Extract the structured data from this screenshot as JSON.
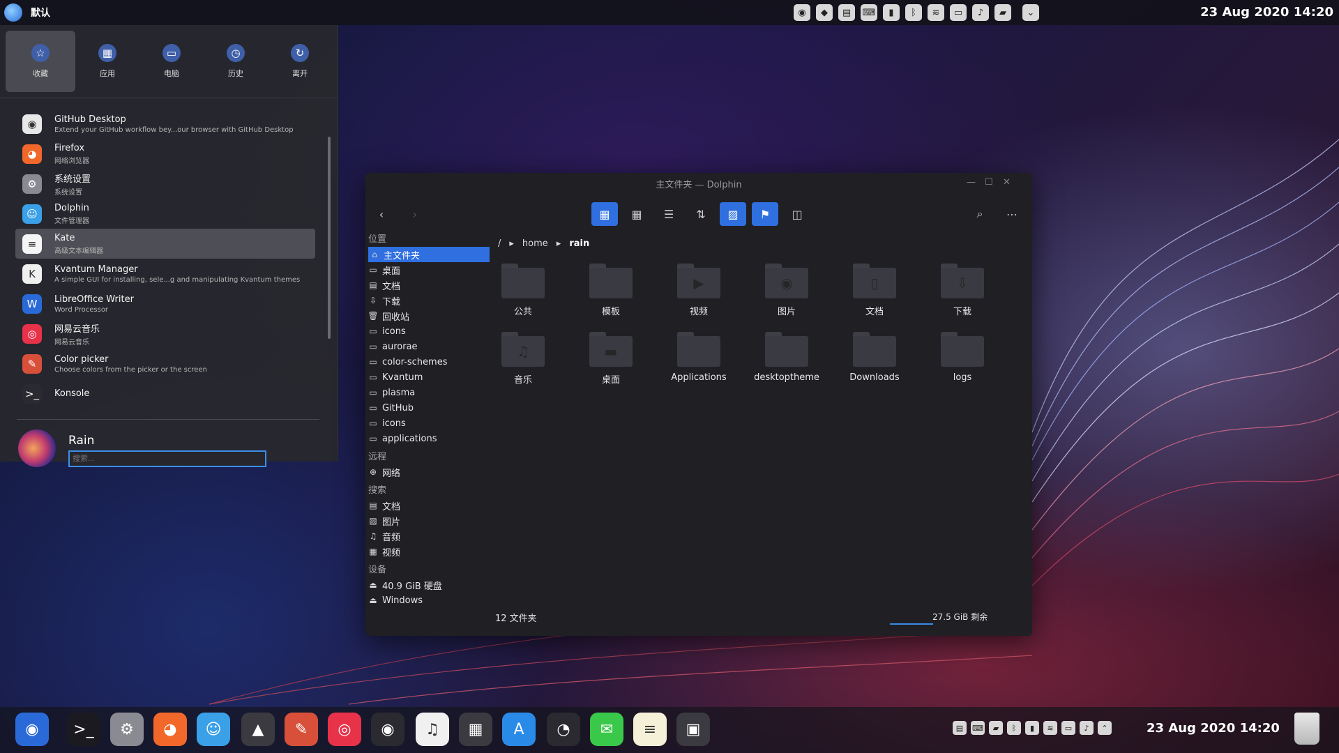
{
  "topbar": {
    "title": "默认",
    "clock": "23 Aug 2020 14:20",
    "tray_icons": [
      "screenshot-icon",
      "notification-icon",
      "clipboard-icon",
      "keyboard-icon",
      "battery-icon",
      "bluetooth-icon",
      "wifi-icon",
      "display-icon",
      "volume-icon",
      "battery-status-icon"
    ]
  },
  "launcher": {
    "tabs": [
      {
        "label": "收藏",
        "icon": "star-icon",
        "glyph": "☆"
      },
      {
        "label": "应用",
        "icon": "apps-icon",
        "glyph": "▦"
      },
      {
        "label": "电脑",
        "icon": "computer-icon",
        "glyph": "▭"
      },
      {
        "label": "历史",
        "icon": "history-icon",
        "glyph": "◷"
      },
      {
        "label": "离开",
        "icon": "leave-icon",
        "glyph": "↻"
      }
    ],
    "apps": [
      {
        "name": "GitHub Desktop",
        "desc": "Extend your GitHub workflow bey...our browser with GitHub Desktop",
        "color": "#e8e8e8",
        "glyph": "◉"
      },
      {
        "name": "Firefox",
        "desc": "网络浏览器",
        "color": "#f2672a",
        "glyph": "◕"
      },
      {
        "name": "系统设置",
        "desc": "系统设置",
        "color": "#8a8a92",
        "glyph": "⚙"
      },
      {
        "name": "Dolphin",
        "desc": "文件管理器",
        "color": "#3aa0e8",
        "glyph": "☺"
      },
      {
        "name": "Kate",
        "desc": "高级文本编辑器",
        "color": "#f5f5f5",
        "glyph": "≡"
      },
      {
        "name": "Kvantum Manager",
        "desc": "A simple GUI for installing, sele...g and manipulating Kvantum themes",
        "color": "#f0f0f0",
        "glyph": "K"
      },
      {
        "name": "LibreOffice Writer",
        "desc": "Word Processor",
        "color": "#2a6ad8",
        "glyph": "W"
      },
      {
        "name": "网易云音乐",
        "desc": "网易云音乐",
        "color": "#e8324a",
        "glyph": "◎"
      },
      {
        "name": "Color picker",
        "desc": "Choose colors from the picker or the screen",
        "color": "#d8503a",
        "glyph": "✎"
      },
      {
        "name": "Konsole",
        "desc": "",
        "color": "#2a2a30",
        "glyph": ">_"
      }
    ],
    "user": "Rain",
    "search_placeholder": "搜索..."
  },
  "dolphin": {
    "title": "主文件夹 — Dolphin",
    "breadcrumb": [
      "/",
      "home",
      "rain"
    ],
    "places_sections": {
      "places": "位置",
      "remote": "远程",
      "search": "搜索",
      "devices": "设备"
    },
    "places": [
      {
        "label": "主文件夹",
        "glyph": "⌂"
      },
      {
        "label": "桌面",
        "glyph": "▭"
      },
      {
        "label": "文档",
        "glyph": "▤"
      },
      {
        "label": "下载",
        "glyph": "⇩"
      },
      {
        "label": "回收站",
        "glyph": "🗑"
      },
      {
        "label": "icons",
        "glyph": "▭"
      },
      {
        "label": "aurorae",
        "glyph": "▭"
      },
      {
        "label": "color-schemes",
        "glyph": "▭"
      },
      {
        "label": "Kvantum",
        "glyph": "▭"
      },
      {
        "label": "plasma",
        "glyph": "▭"
      },
      {
        "label": "GitHub",
        "glyph": "▭"
      },
      {
        "label": "icons",
        "glyph": "▭"
      },
      {
        "label": "applications",
        "glyph": "▭"
      }
    ],
    "remote": [
      {
        "label": "网络",
        "glyph": "⊕"
      }
    ],
    "search": [
      {
        "label": "文档",
        "glyph": "▤"
      },
      {
        "label": "图片",
        "glyph": "▨"
      },
      {
        "label": "音频",
        "glyph": "♫"
      },
      {
        "label": "视频",
        "glyph": "▦"
      }
    ],
    "devices": [
      {
        "label": "40.9 GiB 硬盘",
        "glyph": "⏏"
      },
      {
        "label": "Windows",
        "glyph": "⏏"
      }
    ],
    "items": [
      {
        "label": "公共",
        "glyph": ""
      },
      {
        "label": "模板",
        "glyph": ""
      },
      {
        "label": "视频",
        "glyph": "▶"
      },
      {
        "label": "图片",
        "glyph": "◉"
      },
      {
        "label": "文档",
        "glyph": "▯"
      },
      {
        "label": "下载",
        "glyph": "⇩"
      },
      {
        "label": "音乐",
        "glyph": "♫"
      },
      {
        "label": "桌面",
        "glyph": "▬"
      },
      {
        "label": "Applications",
        "glyph": ""
      },
      {
        "label": "desktoptheme",
        "glyph": ""
      },
      {
        "label": "Downloads",
        "glyph": ""
      },
      {
        "label": "logs",
        "glyph": ""
      }
    ],
    "status": "12 文件夹",
    "free": "27.5 GiB 剩余"
  },
  "dock": {
    "apps": [
      {
        "name": "launcher",
        "color": "#2a6ad8",
        "glyph": "◉"
      },
      {
        "name": "konsole",
        "color": "#1a1a20",
        "glyph": ">_"
      },
      {
        "name": "system-settings",
        "color": "#8a8a92",
        "glyph": "⚙"
      },
      {
        "name": "firefox",
        "color": "#f2672a",
        "glyph": "◕"
      },
      {
        "name": "dolphin",
        "color": "#3aa0e8",
        "glyph": "☺"
      },
      {
        "name": "kvantum",
        "color": "#3a3a40",
        "glyph": "▲"
      },
      {
        "name": "color-picker",
        "color": "#d8503a",
        "glyph": "✎"
      },
      {
        "name": "netease-music",
        "color": "#e8324a",
        "glyph": "◎"
      },
      {
        "name": "github",
        "color": "#2a2a30",
        "glyph": "◉"
      },
      {
        "name": "music",
        "color": "#f0f0f0",
        "glyph": "♫"
      },
      {
        "name": "calculator",
        "color": "#3a3a40",
        "glyph": "▦"
      },
      {
        "name": "app-store",
        "color": "#2a8ae8",
        "glyph": "A"
      },
      {
        "name": "system-monitor",
        "color": "#2a2a30",
        "glyph": "◔"
      },
      {
        "name": "messages",
        "color": "#3ac84a",
        "glyph": "✉"
      },
      {
        "name": "notes",
        "color": "#f5f0d8",
        "glyph": "≡"
      },
      {
        "name": "screenshot",
        "color": "#3a3a40",
        "glyph": "▣"
      }
    ],
    "clock": "23 Aug 2020 14:20",
    "tray_icons": [
      "clipboard-icon",
      "keyboard-icon",
      "battery-icon",
      "bluetooth-icon",
      "device-icon",
      "wifi-icon",
      "display-icon",
      "volume-icon",
      "expand-icon"
    ]
  }
}
